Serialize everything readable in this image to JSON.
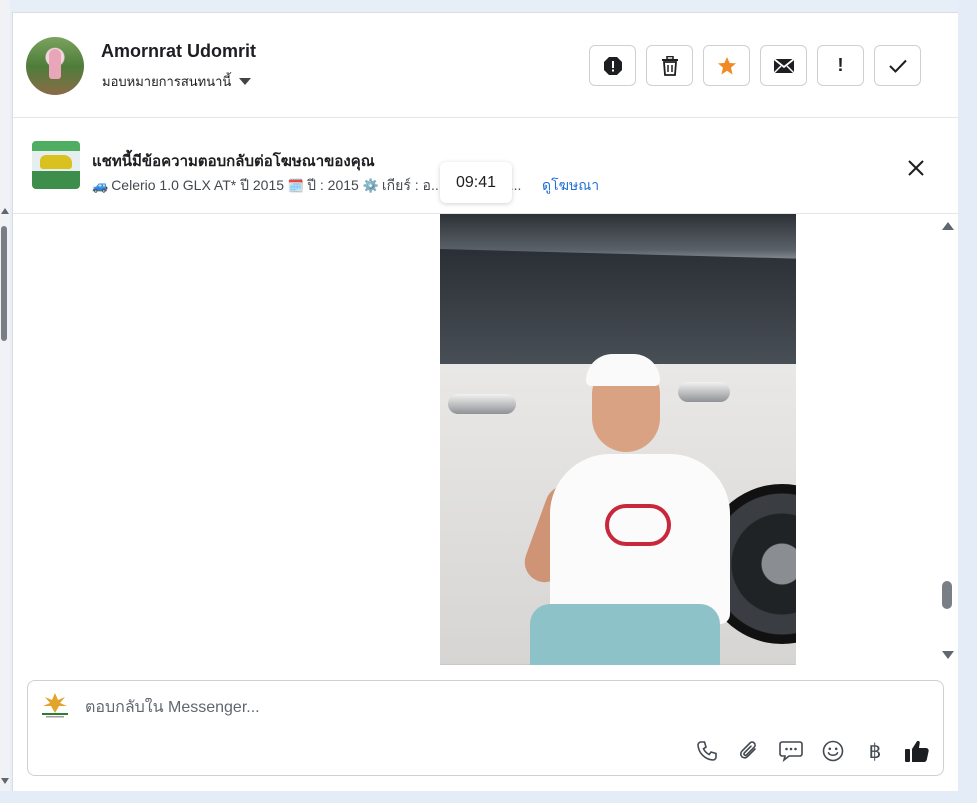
{
  "contact": {
    "name": "Amornrat Udomrit",
    "assign_label": "มอบหมายการสนทนานี้"
  },
  "actions": [
    {
      "name": "block-icon",
      "label": ""
    },
    {
      "name": "trash-icon",
      "label": ""
    },
    {
      "name": "star-icon",
      "label": "",
      "color": "#f08a24"
    },
    {
      "name": "envelope-icon",
      "label": ""
    },
    {
      "name": "exclamation-icon",
      "label": "!"
    },
    {
      "name": "checkmark-icon",
      "label": ""
    }
  ],
  "ad": {
    "title": "แชทนี้มีข้อความตอบกลับต่อโฆษณาของคุณ",
    "desc_car_icon": "🚙",
    "desc_model": "Celerio 1.0 GLX AT* ปี 2015",
    "desc_calendar_icon": "🗓️",
    "desc_year": "ปี : 2015",
    "desc_gear_icon": "⚙️",
    "desc_gear": "เกียร์ : อ...",
    "desc_tail": "พ...",
    "link": "ดูโฆษณา"
  },
  "time_tooltip": "09:41",
  "composer": {
    "placeholder": "ตอบกลับใน Messenger...",
    "tools": [
      "phone-icon",
      "paperclip-icon",
      "chat-bubble-icon",
      "emoji-icon",
      "baht-icon",
      "thumbs-up-icon"
    ],
    "baht_symbol": "฿"
  },
  "colors": {
    "accent_star": "#f08a24",
    "link": "#216fdb",
    "thumbs_up": "#1c1e21"
  }
}
